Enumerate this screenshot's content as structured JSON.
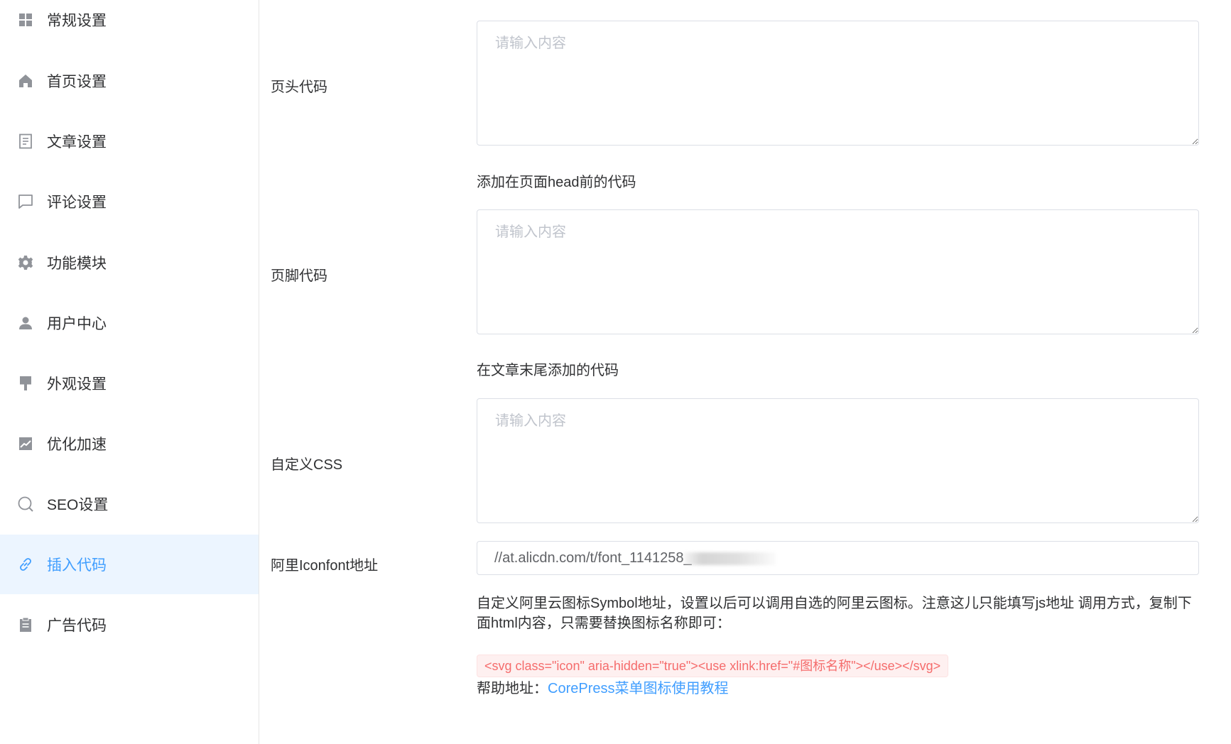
{
  "sidebar": {
    "items": [
      {
        "label": "常规设置",
        "icon": "grid-icon"
      },
      {
        "label": "首页设置",
        "icon": "home-icon"
      },
      {
        "label": "文章设置",
        "icon": "document-icon"
      },
      {
        "label": "评论设置",
        "icon": "comment-icon"
      },
      {
        "label": "功能模块",
        "icon": "gear-icon"
      },
      {
        "label": "用户中心",
        "icon": "user-icon"
      },
      {
        "label": "外观设置",
        "icon": "brush-icon"
      },
      {
        "label": "优化加速",
        "icon": "chart-icon"
      },
      {
        "label": "SEO设置",
        "icon": "search-icon"
      },
      {
        "label": "插入代码",
        "icon": "link-icon",
        "active": true
      },
      {
        "label": "广告代码",
        "icon": "clipboard-icon"
      }
    ]
  },
  "form": {
    "header_code": {
      "label": "页头代码",
      "placeholder": "请输入内容",
      "hint": "添加在页面head前的代码"
    },
    "footer_code": {
      "label": "页脚代码",
      "placeholder": "请输入内容",
      "hint": "在文章末尾添加的代码"
    },
    "custom_css": {
      "label": "自定义CSS",
      "placeholder": "请输入内容"
    },
    "iconfont": {
      "label": "阿里Iconfont地址",
      "value": "//at.alicdn.com/t/font_1141258_",
      "description": "自定义阿里云图标Symbol地址，设置以后可以调用自选的阿里云图标。注意这儿只能填写js地址 调用方式，复制下面html内容，只需要替换图标名称即可：",
      "code_sample": "<svg class=\"icon\" aria-hidden=\"true\"><use xlink:href=\"#图标名称\"></use></svg>",
      "help_prefix": "帮助地址：",
      "help_link": "CorePress菜单图标使用教程"
    }
  },
  "colors": {
    "accent": "#409eff",
    "active_bg": "#ecf5ff",
    "border": "#dcdfe6",
    "danger": "#f56c6c",
    "danger_bg": "#fef0f0"
  }
}
